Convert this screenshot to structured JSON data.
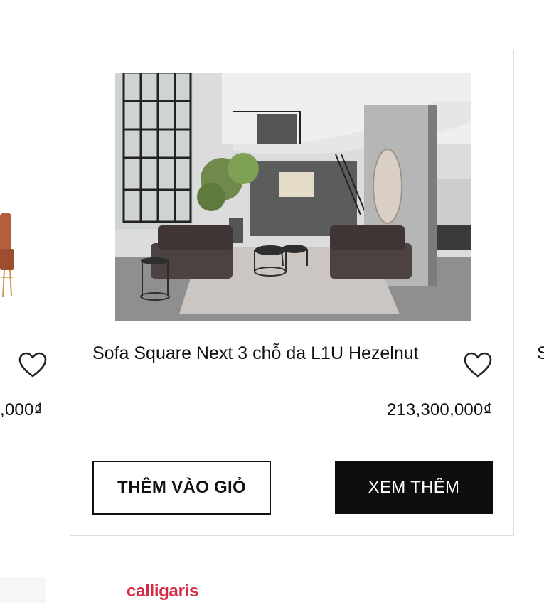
{
  "left_card": {
    "price": ",000₫"
  },
  "main_card": {
    "title": "Sofa Square Next 3 chỗ da L1U Hezelnut",
    "price": "213,300,000₫",
    "add_to_cart_label": "THÊM VÀO GIỎ",
    "view_more_label": "XEM THÊM"
  },
  "right_card": {
    "title_peek": "S"
  },
  "brand": {
    "logo_text": "calligaris",
    "color": "#d62b45"
  },
  "icons": {
    "wishlist": "heart-outline-icon"
  }
}
